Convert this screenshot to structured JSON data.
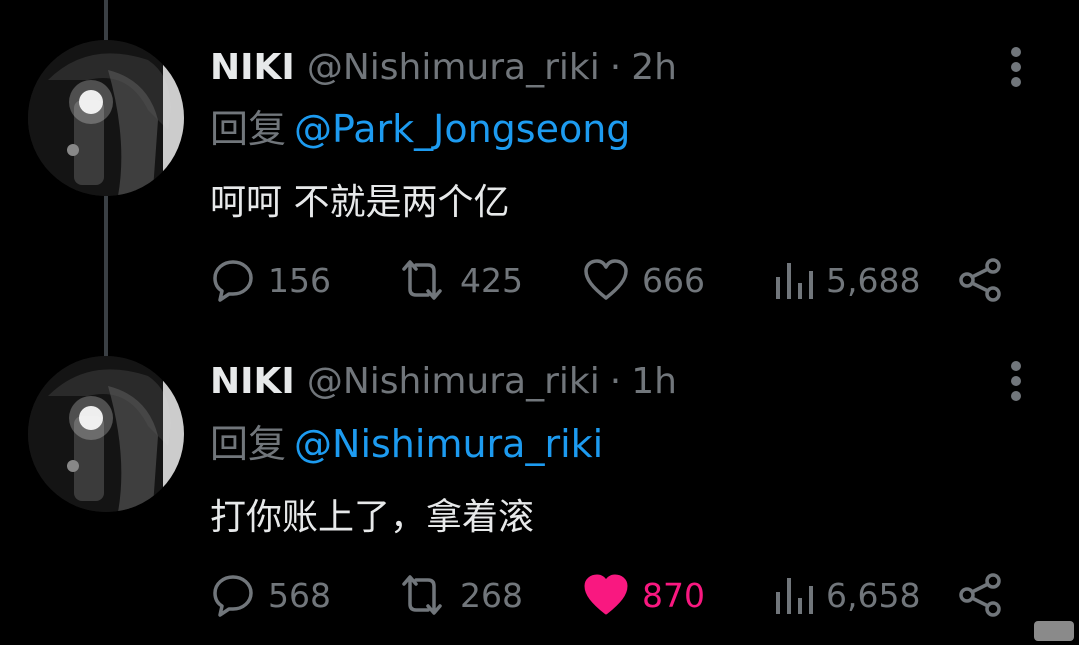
{
  "tweets": [
    {
      "name": "NIKI",
      "handle": "@Nishimura_riki",
      "separator": "·",
      "time": "2h",
      "reply_prefix": "回复",
      "reply_to": "@Park_Jongseong",
      "text": "呵呵 不就是两个亿",
      "replies": "156",
      "retweets": "425",
      "likes": "666",
      "views": "5,688",
      "liked": false
    },
    {
      "name": "NIKI",
      "handle": "@Nishimura_riki",
      "separator": "·",
      "time": "1h",
      "reply_prefix": "回复",
      "reply_to": "@Nishimura_riki",
      "text": "打你账上了，拿着滚",
      "replies": "568",
      "retweets": "268",
      "likes": "870",
      "views": "6,658",
      "liked": true
    }
  ],
  "icons": {
    "reply": "speech-bubble-icon",
    "retweet": "retweet-icon",
    "like": "heart-icon",
    "views": "bar-chart-icon",
    "share": "share-icon",
    "more": "more-vertical-icon"
  },
  "colors": {
    "background": "#000000",
    "name": "#e7e9ea",
    "secondary": "#71767b",
    "mention": "#1d9bf0",
    "liked": "#f91880",
    "thread_line": "#3a3f44"
  }
}
